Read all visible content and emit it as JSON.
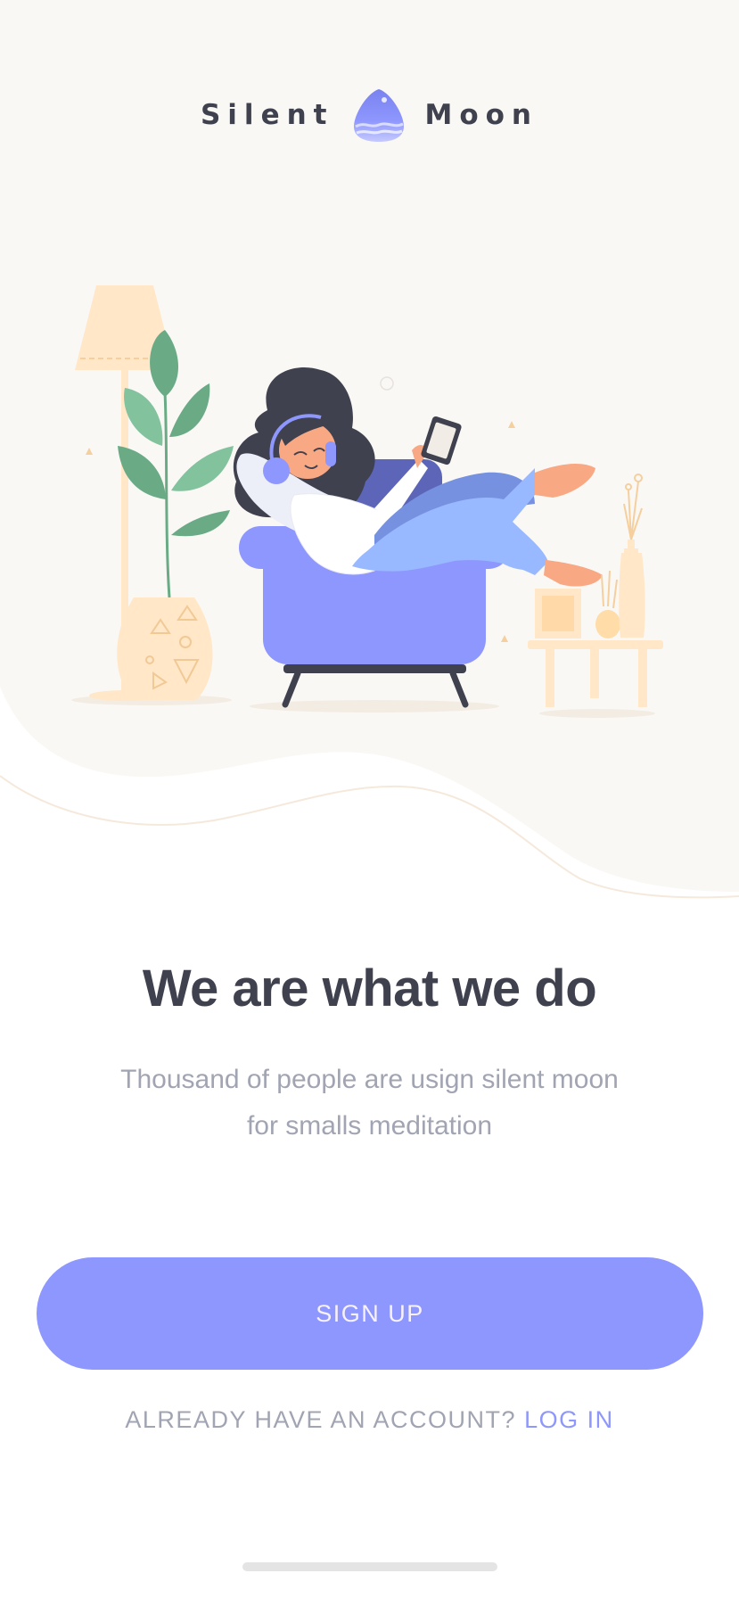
{
  "brand": {
    "left_word": "Silent",
    "right_word": "Moon",
    "logo_icon": "moon-logo-icon"
  },
  "illustration": {
    "icon": "woman-relaxing-in-armchair-illustration"
  },
  "headline": "We are what we do",
  "subtitle": {
    "line1": "Thousand of people are usign silent moon",
    "line2": "for smalls meditation"
  },
  "signup": {
    "label": "SIGN UP"
  },
  "login": {
    "prompt": "ALREADY HAVE AN ACCOUNT?",
    "link_label": "LOG IN"
  },
  "colors": {
    "accent": "#8e97fd",
    "heading": "#3f414e",
    "muted": "#a1a4b2",
    "hero_bg": "#faf8f5"
  }
}
